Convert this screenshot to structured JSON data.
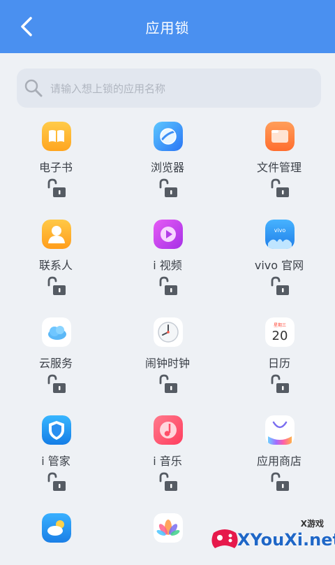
{
  "header": {
    "title": "应用锁",
    "bg": "#4a90f0"
  },
  "search": {
    "placeholder": "请输入想上锁的应用名称",
    "icon": "search-icon"
  },
  "apps": [
    {
      "name": "电子书",
      "icon": "ebook-icon",
      "locked": false
    },
    {
      "name": "浏览器",
      "icon": "browser-icon",
      "locked": false
    },
    {
      "name": "文件管理",
      "icon": "file-manager-icon",
      "locked": false
    },
    {
      "name": "联系人",
      "icon": "contacts-icon",
      "locked": false
    },
    {
      "name": "i 视频",
      "icon": "video-icon",
      "locked": false
    },
    {
      "name": "vivo 官网",
      "icon": "vivo-official-icon",
      "locked": false,
      "icon_text": "vivo"
    },
    {
      "name": "云服务",
      "icon": "cloud-service-icon",
      "locked": false
    },
    {
      "name": "闹钟时钟",
      "icon": "clock-icon",
      "locked": false
    },
    {
      "name": "日历",
      "icon": "calendar-icon",
      "locked": false,
      "icon_text": "星期三",
      "icon_number": "20"
    },
    {
      "name": "i 管家",
      "icon": "manager-shield-icon",
      "locked": false
    },
    {
      "name": "i 音乐",
      "icon": "music-icon",
      "locked": false
    },
    {
      "name": "应用商店",
      "icon": "app-store-icon",
      "locked": false
    }
  ],
  "watermark": {
    "text": "XYouXi.net",
    "small": "X游戏"
  }
}
